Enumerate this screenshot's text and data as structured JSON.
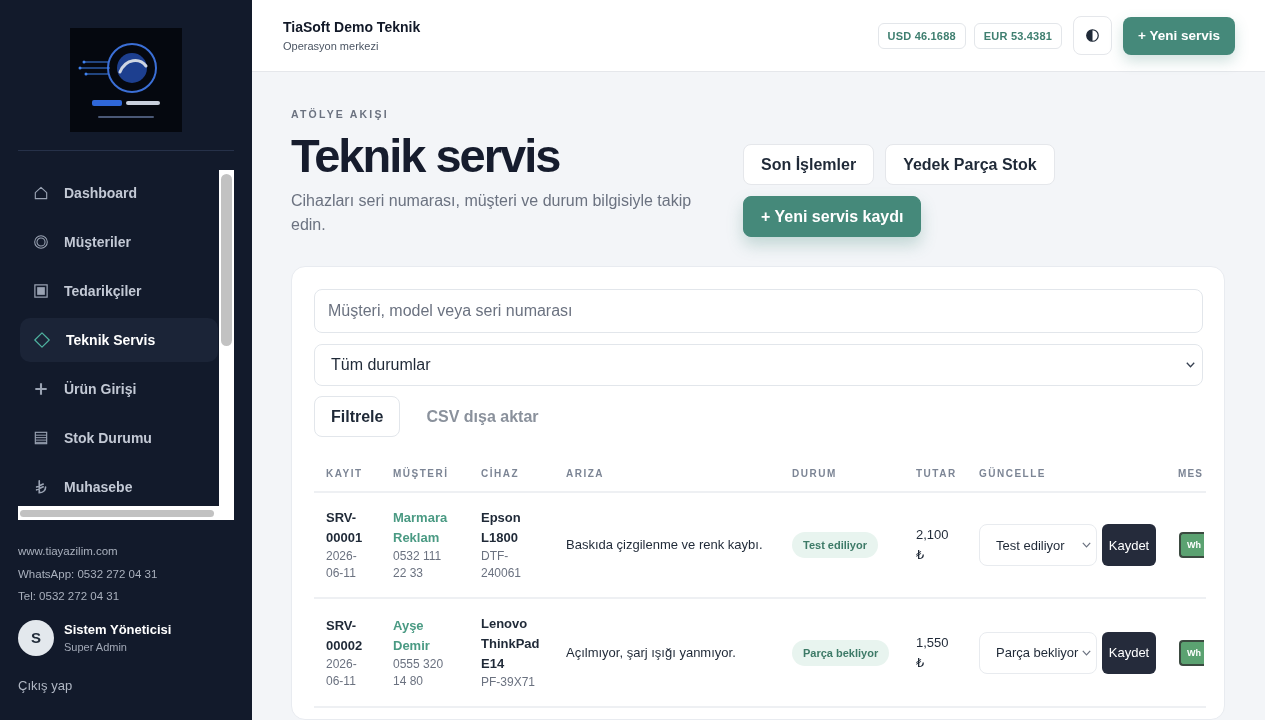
{
  "sidebar": {
    "nav_items": [
      {
        "label": "Dashboard",
        "selected": false
      },
      {
        "label": "Müşteriler",
        "selected": false
      },
      {
        "label": "Tedarikçiler",
        "selected": false
      },
      {
        "label": "Teknik Servis",
        "selected": true
      },
      {
        "label": "Ürün Girişi",
        "selected": false
      },
      {
        "label": "Stok Durumu",
        "selected": false
      },
      {
        "label": "Muhasebe",
        "selected": false
      }
    ],
    "contact": [
      "www.tiayazilim.com",
      "WhatsApp: 0532 272 04 31",
      "Tel: 0532 272 04 31"
    ],
    "user": {
      "initial": "S",
      "name": "Sistem Yöneticisi",
      "role": "Super Admin"
    },
    "logout": "Çıkış yap"
  },
  "header": {
    "title": "TiaSoft Demo Teknik",
    "subtitle": "Operasyon merkezi",
    "rates": [
      "USD 46.1688",
      "EUR 53.4381"
    ],
    "new_button": "+ Yeni servis"
  },
  "page": {
    "eyebrow": "ATÖLYE AKIŞI",
    "title": "Teknik servis",
    "description": "Cihazları seri numarası, müşteri ve durum bilgisiyle takip edin.",
    "actions": [
      {
        "label": "Son İşlemler",
        "kind": "secondary"
      },
      {
        "label": "Yedek Parça Stok",
        "kind": "secondary"
      },
      {
        "label": "+ Yeni servis kaydı",
        "kind": "primary"
      }
    ]
  },
  "filters": {
    "search": {
      "placeholder": "Müşteri, model veya seri numarası"
    },
    "status_select": {
      "value": "Tüm durumlar"
    },
    "buttons": [
      {
        "label": "Filtrele",
        "kind": "outline"
      },
      {
        "label": "CSV dışa aktar",
        "kind": "ghost"
      }
    ]
  },
  "table": {
    "columns": [
      "KAYIT",
      "MÜŞTERİ",
      "CİHAZ",
      "ARIZA",
      "DURUM",
      "TUTAR",
      "GÜNCELLE",
      "MES"
    ],
    "rows": [
      {
        "record": "SRV-00001",
        "date": "2026-06-11",
        "customer": "Marmara Reklam",
        "phone": "0532 111 22 33",
        "device": "Epson L1800",
        "serial": "DTF-240061",
        "fault": "Baskıda çizgilenme ve renk kaybı.",
        "status": "Test ediliyor",
        "amount": "2,100 ₺",
        "update_value": "Test ediliyor",
        "save": "Kaydet",
        "message": "Wh"
      },
      {
        "record": "SRV-00002",
        "date": "2026-06-11",
        "customer": "Ayşe Demir",
        "phone": "0555 320 14 80",
        "device": "Lenovo ThinkPad E14",
        "serial": "PF-39X71",
        "fault": "Açılmıyor, şarj ışığı yanmıyor.",
        "status": "Parça bekliyor",
        "amount": "1,550 ₺",
        "update_value": "Parça bekliyor",
        "save": "Kaydet",
        "message": "Wh"
      }
    ]
  }
}
